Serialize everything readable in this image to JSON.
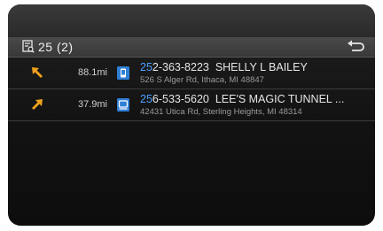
{
  "header": {
    "count_label": "25 (2)",
    "list_icon": "phonebook-search-icon",
    "back_icon": "back-arrow-icon"
  },
  "results": [
    {
      "direction_icon": "arrow-northwest-icon",
      "distance": "88.1mi",
      "category_icon": "phone-category-icon",
      "phone_highlight": "25",
      "phone_rest": "2-363-8223",
      "name": "SHELLY L BAILEY",
      "address": "526 S Alger Rd, Ithaca, MI 48847"
    },
    {
      "direction_icon": "arrow-northeast-icon",
      "distance": "37.9mi",
      "category_icon": "business-category-icon",
      "phone_highlight": "25",
      "phone_rest": "6-533-5620",
      "name": "LEE'S MAGIC TUNNEL ...",
      "address": "42431 Utica Rd, Sterling Heights, MI 48314"
    }
  ],
  "colors": {
    "highlight": "#4aa0ff",
    "arrow": "#f0a21e",
    "icon_blue": "#2f7fd6"
  }
}
